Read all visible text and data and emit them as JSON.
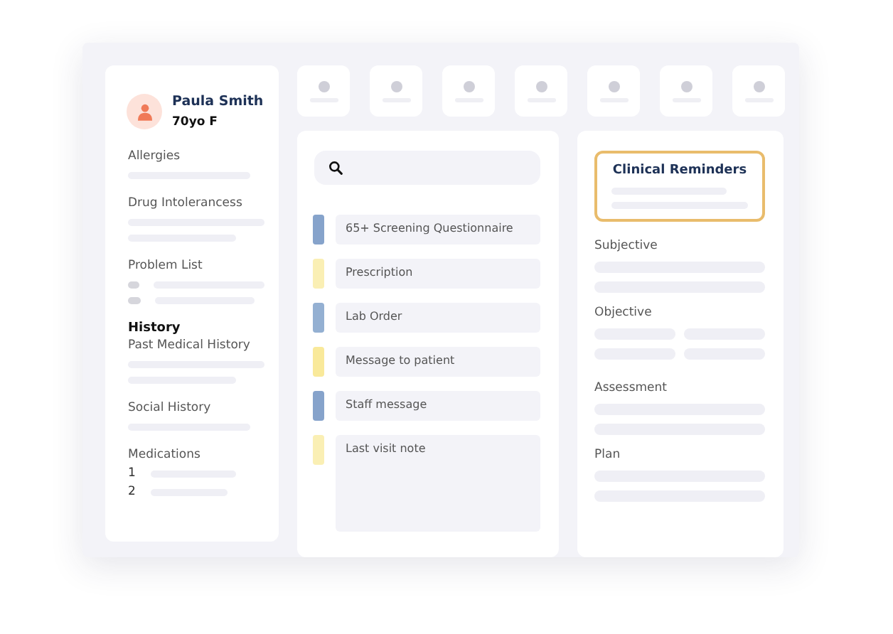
{
  "patient": {
    "name": "Paula Smith",
    "details": "70yo F"
  },
  "sidebar": {
    "sections": [
      {
        "label": "Allergies",
        "kind": "single"
      },
      {
        "label": "Drug Intolerancess",
        "kind": "double"
      },
      {
        "label": "Problem List",
        "kind": "bullets"
      },
      {
        "label": "History",
        "kind": "heading"
      },
      {
        "label": "Past Medical History",
        "kind": "double"
      },
      {
        "label": "Social History",
        "kind": "single"
      },
      {
        "label": "Medications",
        "kind": "numbered",
        "items": [
          "1",
          "2"
        ]
      }
    ]
  },
  "orders": [
    {
      "label": "65+ Screening Questionnaire",
      "color": "#86a3cb",
      "kind": "row"
    },
    {
      "label": "Prescription",
      "color": "#faefb4",
      "kind": "row"
    },
    {
      "label": "Lab Order",
      "color": "#94b0d2",
      "kind": "row"
    },
    {
      "label": "Message to patient",
      "color": "#f9e99a",
      "kind": "row"
    },
    {
      "label": "Staff message",
      "color": "#86a3cb",
      "kind": "row"
    },
    {
      "label": "Last visit note",
      "color": "#faefb4",
      "kind": "note"
    }
  ],
  "reminders": {
    "title": "Clinical Reminders"
  },
  "notes": [
    {
      "label": "Subjective",
      "kind": "lines"
    },
    {
      "label": "Objective",
      "kind": "grid"
    },
    {
      "label": "Assessment",
      "kind": "lines"
    },
    {
      "label": "Plan",
      "kind": "lines"
    }
  ]
}
